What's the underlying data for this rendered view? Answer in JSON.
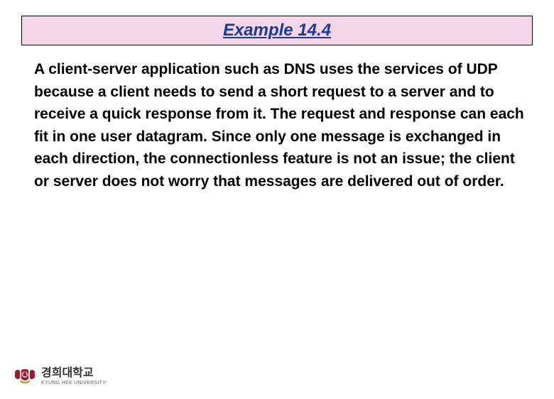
{
  "header": {
    "title": "Example 14.4"
  },
  "body": {
    "paragraph": "A client-server application such as DNS uses the services of UDP because a client needs to send a short request to a server and to receive a quick response from it. The request and response can each fit in one user datagram. Since only one message is exchanged in each direction, the connectionless feature is not an issue; the client or server does not worry that messages are delivered out of order."
  },
  "footer": {
    "university_korean": "경희대학교",
    "university_english": "KYUNG HEE UNIVERSITY"
  }
}
